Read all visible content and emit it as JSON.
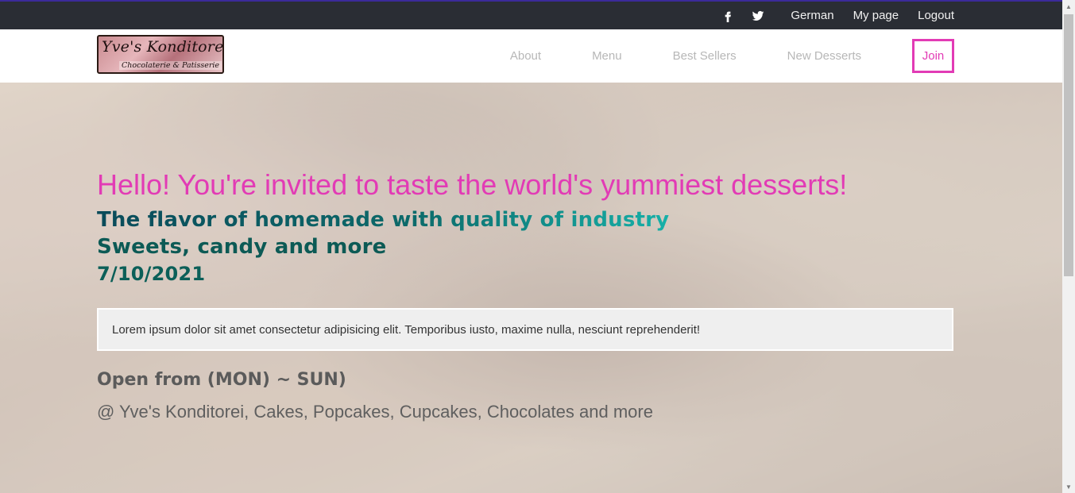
{
  "topbar": {
    "icons": [
      "facebook-icon",
      "twitter-icon"
    ],
    "links": [
      "German",
      "My page",
      "Logout"
    ]
  },
  "brand": {
    "logo_title": "Yve's Konditorei",
    "logo_subtitle": "Chocolaterie & Patisserie"
  },
  "nav": {
    "items": [
      "About",
      "Menu",
      "Best Sellers",
      "New Desserts"
    ],
    "join_label": "Join",
    "accent_color": "#e23bb5"
  },
  "hero": {
    "headline": "Hello! You're invited to taste the world's yummiest desserts!",
    "line1": "The flavor of homemade with quality of industry",
    "line2": "Sweets, candy and more",
    "date": "7/10/2021",
    "notice": "Lorem ipsum dolor sit amet consectetur adipisicing elit. Temporibus iusto, maxime nulla, nesciunt reprehenderit!",
    "open_hours": "Open from (MON) ~ SUN)",
    "location": "@ Yve's Konditorei, Cakes, Popcakes, Cupcakes, Chocolates and more"
  }
}
